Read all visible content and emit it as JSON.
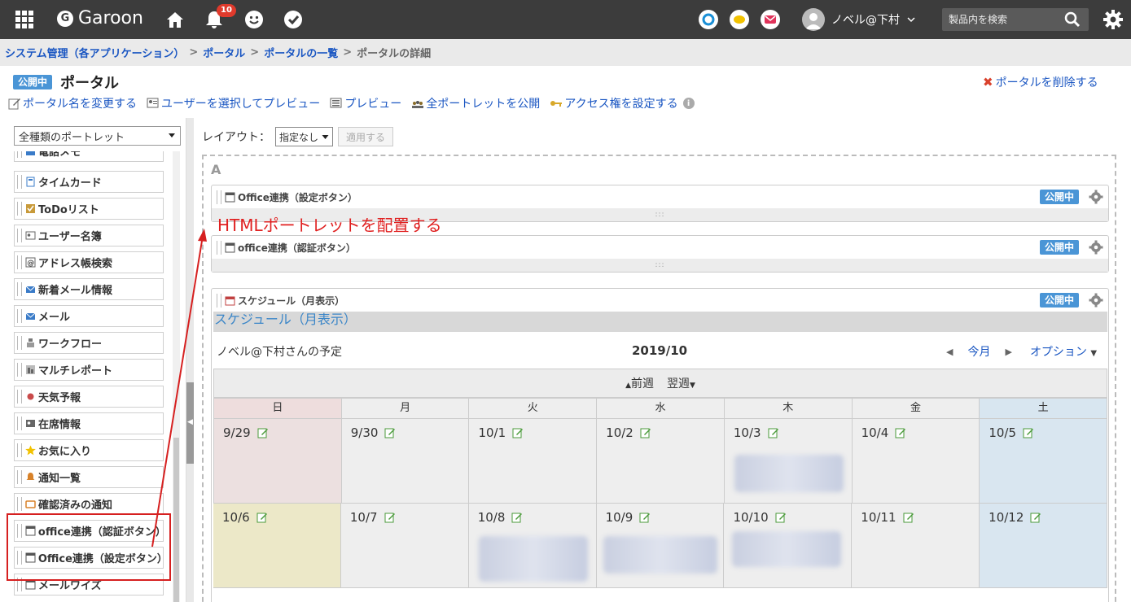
{
  "topbar": {
    "brand": "Garoon",
    "brand_mark": "G",
    "notification_count": "10",
    "user_name": "ノベル@下村",
    "search_placeholder": "製品内を検索"
  },
  "breadcrumb": {
    "items": [
      "システム管理（各アプリケーション）",
      "ポータル",
      "ポータルの一覧"
    ],
    "current": "ポータルの詳細"
  },
  "page": {
    "status": "公開中",
    "title": "ポータル",
    "delete_label": "ポータルを削除する"
  },
  "actions": [
    {
      "label": "ポータル名を変更する"
    },
    {
      "label": "ユーザーを選択してプレビュー"
    },
    {
      "label": "プレビュー"
    },
    {
      "label": "全ポートレットを公開"
    },
    {
      "label": "アクセス権を設定する"
    }
  ],
  "left": {
    "type_select": "全種類のポートレット",
    "portlets": [
      "電話メモ",
      "タイムカード",
      "ToDoリスト",
      "ユーザー名簿",
      "アドレス帳検索",
      "新着メール情報",
      "メール",
      "ワークフロー",
      "マルチレポート",
      "天気予報",
      "在席情報",
      "お気に入り",
      "通知一覧",
      "確認済みの通知",
      "office連携（認証ボタン）",
      "Office連携（設定ボタン）",
      "メールワイズ"
    ]
  },
  "layout": {
    "label": "レイアウト：",
    "selected": "指定なし",
    "apply_label": "適用する",
    "zone": "A"
  },
  "annotation": "HTMLポートレットを配置する",
  "portlets": [
    {
      "title": "Office連携（設定ボタン）",
      "status": "公開中"
    },
    {
      "title": "office連携（認証ボタン）",
      "status": "公開中"
    },
    {
      "title": "スケジュール（月表示）",
      "status": "公開中"
    }
  ],
  "schedule": {
    "heading": "スケジュール（月表示）",
    "owner": "ノベル@下村さんの予定",
    "month": "2019/10",
    "today_label": "今月",
    "option_label": "オプション",
    "prev_week": "前週",
    "next_week": "翌週",
    "weekdays": [
      "日",
      "月",
      "火",
      "水",
      "木",
      "金",
      "土"
    ],
    "weeks": [
      [
        "9/29",
        "9/30",
        "10/1",
        "10/2",
        "10/3",
        "10/4",
        "10/5"
      ],
      [
        "10/6",
        "10/7",
        "10/8",
        "10/9",
        "10/10",
        "10/11",
        "10/12"
      ]
    ]
  },
  "colors": {
    "topbar": "#3c3c3c",
    "link": "#1a56c2",
    "status": "#4a95d6",
    "annotation": "#e02020"
  }
}
